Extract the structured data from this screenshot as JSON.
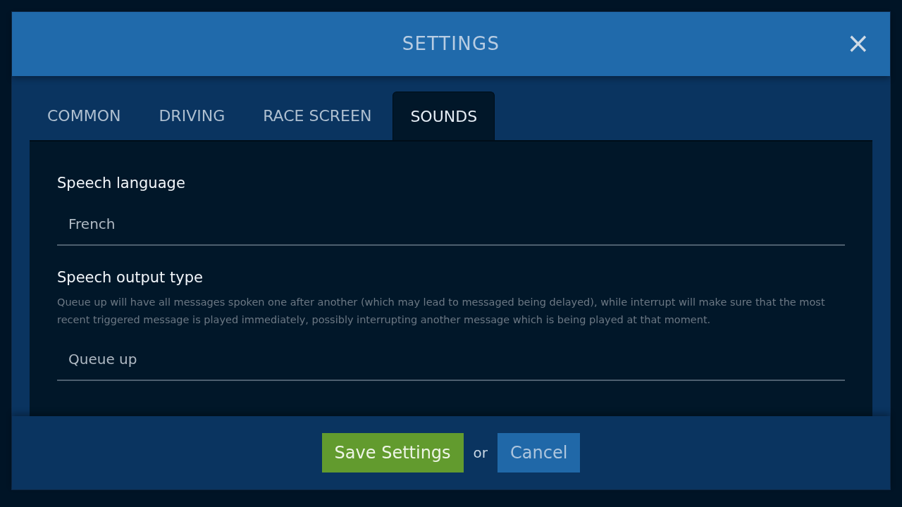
{
  "dialog": {
    "title": "SETTINGS",
    "close": "×"
  },
  "tabs": [
    {
      "label": "COMMON",
      "selected": false
    },
    {
      "label": "DRIVING",
      "selected": false
    },
    {
      "label": "RACE SCREEN",
      "selected": false
    },
    {
      "label": "SOUNDS",
      "selected": true
    }
  ],
  "settings": [
    {
      "label": "Speech language",
      "value": "French"
    },
    {
      "label": "Speech output type",
      "description": "Queue up will have all messages spoken one after another (which may lead to messaged being delayed), while interrupt will make sure that the most recent triggered message is played immediately, possibly interrupting another message which is being played at that moment.",
      "value": "Queue up"
    }
  ],
  "footer": {
    "save": "Save Settings",
    "separator": "or",
    "cancel": "Cancel"
  }
}
